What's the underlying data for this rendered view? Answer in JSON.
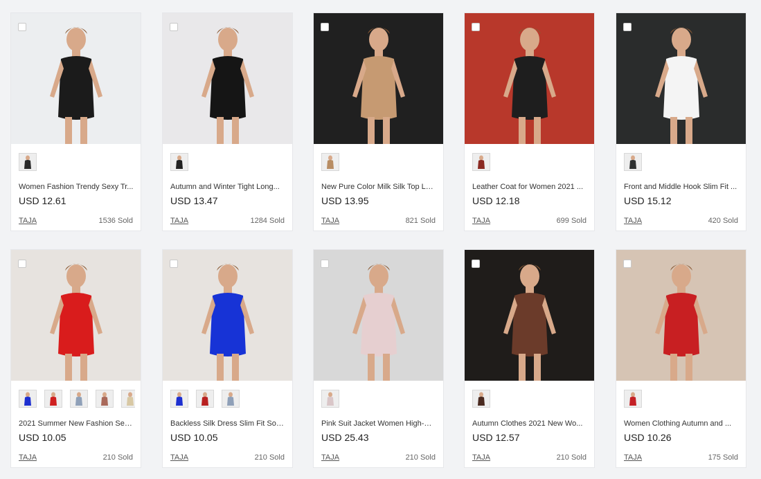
{
  "products": [
    {
      "title": "Women Fashion Trendy Sexy Tr...",
      "price": "USD 12.61",
      "store": "TAJA",
      "sold": "1536 Sold",
      "bg": "#eceef0",
      "dress": "#1b1b1b",
      "thumbs": [
        "#2a2a2a"
      ]
    },
    {
      "title": "Autumn and Winter Tight Long...",
      "price": "USD 13.47",
      "store": "TAJA",
      "sold": "1284 Sold",
      "bg": "#e9e8ea",
      "dress": "#151515",
      "thumbs": [
        "#222222"
      ]
    },
    {
      "title": "New Pure Color Milk Silk Top Lo...",
      "price": "USD 13.95",
      "store": "TAJA",
      "sold": "821 Sold",
      "bg": "#202020",
      "dress": "#c69a72",
      "thumbs": [
        "#b88d63"
      ]
    },
    {
      "title": "Leather Coat for Women 2021 ...",
      "price": "USD 12.18",
      "store": "TAJA",
      "sold": "699 Sold",
      "bg": "#b8382b",
      "dress": "#1e1e1e",
      "thumbs": [
        "#8b2a22"
      ]
    },
    {
      "title": "Front and Middle Hook Slim Fit ...",
      "price": "USD 15.12",
      "store": "TAJA",
      "sold": "420 Sold",
      "bg": "#2a2c2c",
      "dress": "#f4f4f4",
      "thumbs": [
        "#2f3131"
      ]
    },
    {
      "title": "2021 Summer New Fashion Sex...",
      "price": "USD 10.05",
      "store": "TAJA",
      "sold": "210 Sold",
      "bg": "#e7e3df",
      "dress": "#d91c1c",
      "thumbs": [
        "#1d2fd0",
        "#cf2020",
        "#8fa0b8",
        "#a9695a",
        "#d8c8a4"
      ]
    },
    {
      "title": "Backless Silk Dress Slim Fit Soci...",
      "price": "USD 10.05",
      "store": "TAJA",
      "sold": "210 Sold",
      "bg": "#e7e3df",
      "dress": "#1733d6",
      "thumbs": [
        "#1d2fd0",
        "#b82121",
        "#8fa0b8"
      ]
    },
    {
      "title": "Pink Suit Jacket Women High-G...",
      "price": "USD 25.43",
      "store": "TAJA",
      "sold": "210 Sold",
      "bg": "#d8d8d8",
      "dress": "#e6cfd0",
      "thumbs": [
        "#d9c6c8"
      ]
    },
    {
      "title": "Autumn Clothes 2021 New Wo...",
      "price": "USD 12.57",
      "store": "TAJA",
      "sold": "210 Sold",
      "bg": "#1f1c1a",
      "dress": "#6b3b2a",
      "thumbs": [
        "#4a2a20"
      ]
    },
    {
      "title": "Women Clothing Autumn and ...",
      "price": "USD 10.26",
      "store": "TAJA",
      "sold": "175 Sold",
      "bg": "#d6c4b4",
      "dress": "#c81f22",
      "thumbs": [
        "#c42025"
      ]
    }
  ]
}
